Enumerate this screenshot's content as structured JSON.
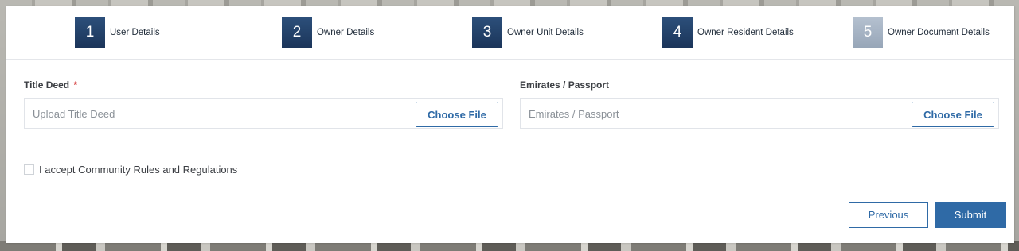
{
  "steps": [
    {
      "number": "1",
      "label": "User Details",
      "active": true
    },
    {
      "number": "2",
      "label": "Owner Details",
      "active": true
    },
    {
      "number": "3",
      "label": "Owner Unit Details",
      "active": true
    },
    {
      "number": "4",
      "label": "Owner Resident Details",
      "active": true
    },
    {
      "number": "5",
      "label": "Owner Document Details",
      "active": false
    }
  ],
  "fields": {
    "title_deed": {
      "label": "Title Deed",
      "required_mark": "*",
      "placeholder": "Upload Title Deed",
      "button": "Choose File"
    },
    "emirates_passport": {
      "label": "Emirates / Passport",
      "placeholder": "Emirates / Passport",
      "button": "Choose File"
    }
  },
  "agreement": {
    "label": "I accept Community Rules and Regulations",
    "checked": false
  },
  "actions": {
    "previous": "Previous",
    "submit": "Submit"
  },
  "colors": {
    "accent": "#2f6aa6",
    "step_active": "#1f3b62",
    "step_inactive": "#a5b2c3",
    "required": "#d33a3a"
  }
}
